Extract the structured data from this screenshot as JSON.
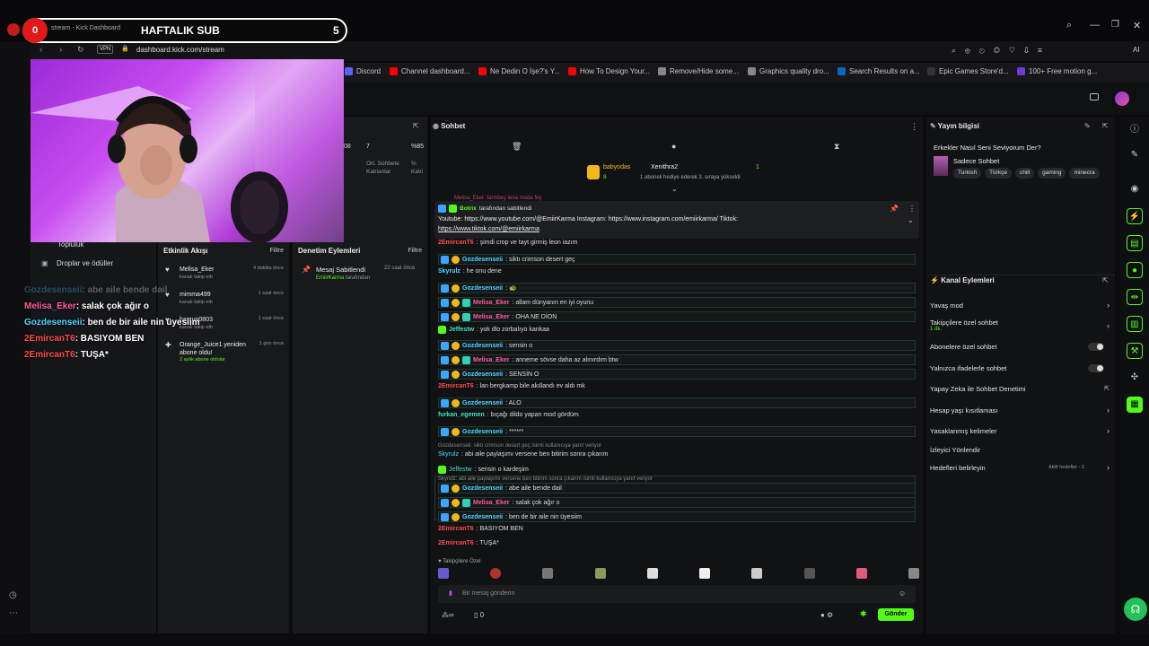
{
  "browser": {
    "tab_title": "stream - Kick Dashboard",
    "url": "dashboard.kick.com/stream",
    "url_badge": "VPN",
    "bookmarks": [
      {
        "label": "Discord",
        "color": "#5865f2"
      },
      {
        "label": "Channel dashboard...",
        "color": "#ff0000"
      },
      {
        "label": "Ne Dedin O İşe?'s Y...",
        "color": "#ff0000"
      },
      {
        "label": "How To Design Your...",
        "color": "#ff0000"
      },
      {
        "label": "Remove/Hide some...",
        "color": "#888888"
      },
      {
        "label": "Graphics quality dro...",
        "color": "#888888"
      },
      {
        "label": "Search Results on a...",
        "color": "#0a66c2"
      },
      {
        "label": "Epic Games Store'd...",
        "color": "#333333"
      },
      {
        "label": "100+ Free motion g...",
        "color": "#6b3ad8"
      }
    ],
    "ai_label": "AI"
  },
  "sub_goal": {
    "count_left": "0",
    "title": "HAFTALIK SUB",
    "target": "5"
  },
  "left_nav": {
    "items": [
      "Topluluk",
      "Droplar ve ödüller"
    ]
  },
  "overlay_chat": [
    {
      "user": "Gozdesenseii",
      "text": ": abe aile bende dail",
      "color": "#4fd6ff",
      "faded": true
    },
    {
      "user": "Melisa_Eker",
      "text": ": salak çok ağır o",
      "color": "#ff5c9e",
      "faded": false
    },
    {
      "user": "Gozdesenseii",
      "text": ": ben de bir aile nin üyesiim",
      "color": "#4fd6ff",
      "faded": false
    },
    {
      "user": "2EmircanT6",
      "text": ": BASIYOM BEN",
      "color": "#ff4a4a",
      "faded": false
    },
    {
      "user": "2EmircanT6",
      "text": ": TUŞA*",
      "color": "#ff4a4a",
      "faded": false
    }
  ],
  "stats": {
    "values": [
      "08",
      "7",
      "%85"
    ],
    "labels": [
      "Ort. Sohbete Katılanlar",
      "% Katıl"
    ]
  },
  "activity": {
    "title": "Etkinlik Akışı",
    "filter": "Filtre",
    "events": [
      {
        "name": "Melisa_Eker",
        "sub": "kanalı takip etti",
        "time": "4 dakika önce"
      },
      {
        "name": "mimma499",
        "sub": "kanalı takip etti",
        "time": "1 saat önce"
      },
      {
        "name": "hayrun0803",
        "sub": "kanalı takip etti",
        "time": "1 saat önce"
      },
      {
        "name": "Orange_Juice1 yeniden abone oldu!",
        "sub": "2 aylık abone oldular",
        "time": "1 gün önce"
      }
    ]
  },
  "moderation": {
    "title": "Denetim Eylemleri",
    "filter": "Filtre",
    "item_title": "Mesaj Sabitlendi",
    "item_by": "EmiirKarma",
    "item_sub": "tarafından",
    "item_time": "22 saat önce"
  },
  "chat": {
    "title": "Sohbet",
    "gift_user": "babyodas",
    "gift_target": "Xenithra2",
    "gift_count": "8",
    "gift_right": "1",
    "gift_text": "1 aboneli hediye ederek 3. sıraya yükseldi",
    "pinned_by": "Botrix",
    "pinned_suffix": "tarafından sabitlendi",
    "pinned_lines": [
      "Youtube: https://www.youtube.com/@EmiirKarma Instagram: https://www.instagram.com/emiirkarma/ Tiktok:",
      "https://www.tiktok.com/@emiirkarma"
    ],
    "pinned_hidden": "Melisa_Eker: farmbey lena moda fey",
    "messages": [
      {
        "user": "2EmircanT6",
        "color": "#ff4a4a",
        "text": ": şimdi crop ve tayt girmiş leon iazım",
        "hl": false,
        "badges": []
      },
      {
        "user": "Gozdesenseii",
        "color": "#4fd6ff",
        "text": ": siktı crimson desert geç",
        "hl": true,
        "badges": [
          "blue",
          "gold"
        ]
      },
      {
        "user": "Skyrulz",
        "color": "#4fd6ff",
        "text": ": he onu dene",
        "hl": false,
        "badges": []
      },
      {
        "user": "Gozdesenseii",
        "color": "#4fd6ff",
        "text": ": 🐢",
        "hl": true,
        "badges": [
          "blue",
          "gold"
        ]
      },
      {
        "user": "Melisa_Eker",
        "color": "#ff5c9e",
        "text": ": allam dünyanın en iyi oyunu",
        "hl": true,
        "badges": [
          "blue",
          "gold",
          "teal"
        ]
      },
      {
        "user": "Melisa_Eker",
        "color": "#ff5c9e",
        "text": ": OHA NE DİON",
        "hl": true,
        "badges": [
          "blue",
          "gold",
          "teal"
        ]
      },
      {
        "user": "Jeffestw",
        "color": "#3ee0c5",
        "text": ": yok dlo zorbalıyo kankaa",
        "hl": false,
        "badges": [
          "green"
        ]
      },
      {
        "user": "Gozdesenseii",
        "color": "#4fd6ff",
        "text": ": sensin o",
        "hl": true,
        "badges": [
          "blue",
          "gold"
        ]
      },
      {
        "user": "Melisa_Eker",
        "color": "#ff5c9e",
        "text": ": anneme sövse daha az alınırdım btw",
        "hl": true,
        "badges": [
          "blue",
          "gold",
          "teal"
        ]
      },
      {
        "user": "Gozdesenseii",
        "color": "#4fd6ff",
        "text": ": SENSİN O",
        "hl": true,
        "badges": [
          "blue",
          "gold"
        ]
      },
      {
        "user": "2EmircanT6",
        "color": "#ff4a4a",
        "text": ": lan bergkamp bile akıllandı ev aldı mk",
        "hl": false,
        "badges": []
      },
      {
        "user": "Gozdesenseii",
        "color": "#4fd6ff",
        "text": ": ALO",
        "hl": true,
        "badges": [
          "blue",
          "gold"
        ]
      },
      {
        "user": "furkan_egemen",
        "color": "#3ee0c5",
        "text": ": bıçağı dildo yapan mod gördüm",
        "hl": false,
        "badges": []
      },
      {
        "user": "Gozdesenseii",
        "color": "#4fd6ff",
        "text": ": ******",
        "hl": true,
        "badges": [
          "blue",
          "gold"
        ]
      }
    ],
    "reply1_ctx": "Gozdesenseii: siktı crimson desert geç isimli kullanıcıya yanıt veriyor",
    "reply1_user": "Skyrulz",
    "reply1_text": ": abi aile paylaşımı versene ben bitirim sonra çıkarım",
    "msg_jeff": {
      "user": "Jeffestw",
      "text": ": sensin o kardeşim"
    },
    "reply2_ctx": "Skyrulz: abi aile paylaşımı versene ben bitirim sonra çıkarım isimli kullanıcıya yanıt veriyor",
    "tail": [
      {
        "user": "Gozdesenseii",
        "color": "#4fd6ff",
        "text": ": abe aile bende dail",
        "hl": true,
        "badges": [
          "blue",
          "gold"
        ]
      },
      {
        "user": "Melisa_Eker",
        "color": "#ff5c9e",
        "text": ": salak çok ağır o",
        "hl": true,
        "badges": [
          "blue",
          "gold",
          "teal"
        ]
      },
      {
        "user": "Gozdesenseii",
        "color": "#4fd6ff",
        "text": ": ben de bir aile nin üyesiim",
        "hl": true,
        "badges": [
          "blue",
          "gold"
        ]
      },
      {
        "user": "2EmircanT6",
        "color": "#ff4a4a",
        "text": ": BASIYOM BEN",
        "hl": false,
        "badges": []
      },
      {
        "user": "2EmircanT6",
        "color": "#ff4a4a",
        "text": ": TUŞA*",
        "hl": false,
        "badges": []
      }
    ],
    "followers_label": "Takipçilere Özel",
    "input_placeholder": "Bir mesaj gönderin",
    "footer_count": "0",
    "send_label": "Gönder"
  },
  "stream_info": {
    "title": "Yayın bilgisi",
    "stream_title": "Erkekler Nasıl Seni Seviyorum Der?",
    "category": "Sadece Sohbet",
    "tags": [
      "Turkish",
      "Türkçe",
      "chill",
      "gaming",
      "minecra"
    ]
  },
  "channel_actions": {
    "title": "Kanal Eylemleri",
    "items": [
      {
        "label": "Yavaş mod",
        "control": "chevron"
      },
      {
        "label": "Takipçilere özel sohbet",
        "sub": "1 dk.",
        "control": "chevron"
      },
      {
        "label": "Abonelere özel sohbet",
        "control": "toggle"
      },
      {
        "label": "Yalnızca ifadelerle sohbet",
        "control": "toggle"
      },
      {
        "label": "Yapay Zeka ile Sohbet Denetimi",
        "control": "external"
      },
      {
        "label": "Hesap yaşı kısıtlaması",
        "control": "chevron"
      },
      {
        "label": "Yasaklanmış kelimeler",
        "control": "chevron"
      },
      {
        "label": "İzleyici Yönlendir",
        "control": "none"
      },
      {
        "label": "Hedefleri belirleyin",
        "control": "chevron",
        "extra": "Aktif hedefler - 2"
      }
    ]
  },
  "colors": {
    "accent": "#53fc18",
    "bg": "#111214"
  }
}
